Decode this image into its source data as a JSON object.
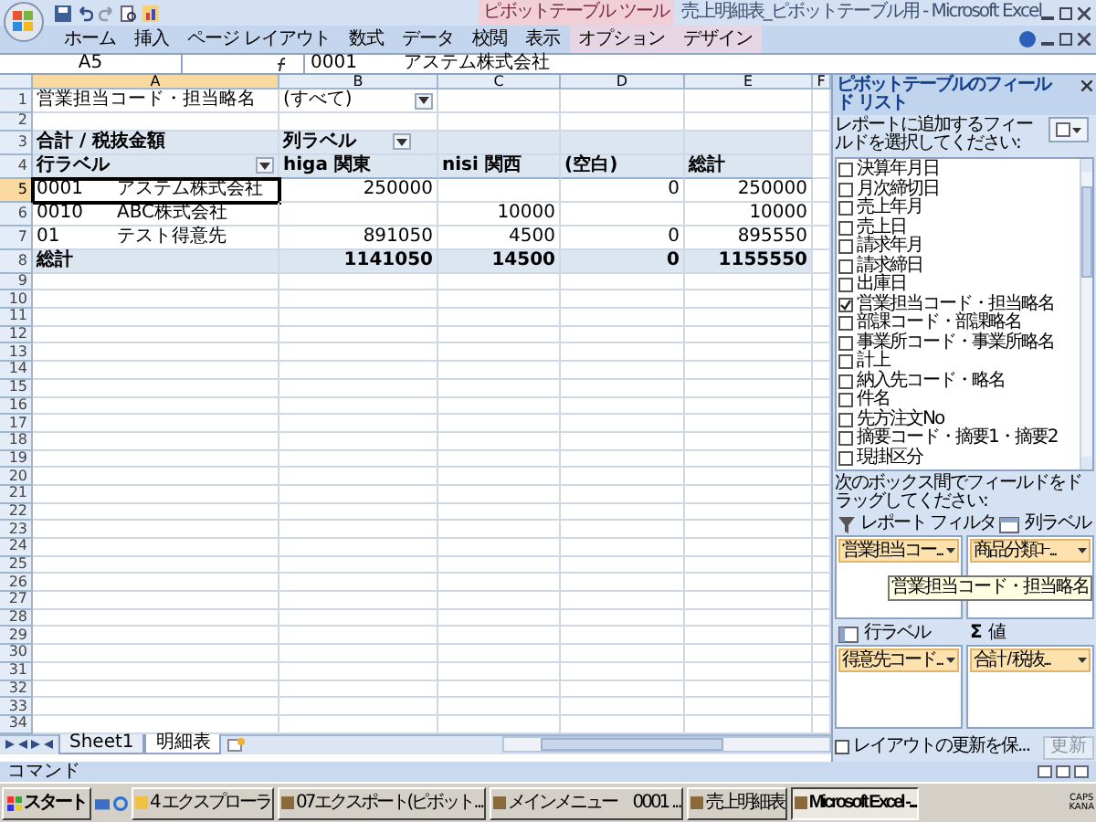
{
  "window": {
    "title": "売上明細表_ピボットテーブル用 - Microsoft Excel",
    "context_tab_group": "ピボットテーブル ツール"
  },
  "ribbon_tabs": [
    {
      "label": "ホーム",
      "contextual": false
    },
    {
      "label": "挿入",
      "contextual": false
    },
    {
      "label": "ページ レイアウト",
      "contextual": false
    },
    {
      "label": "数式",
      "contextual": false
    },
    {
      "label": "データ",
      "contextual": false
    },
    {
      "label": "校閲",
      "contextual": false
    },
    {
      "label": "表示",
      "contextual": false
    },
    {
      "label": "オプション",
      "contextual": true
    },
    {
      "label": "デザイン",
      "contextual": true
    }
  ],
  "formula_bar": {
    "name_box": "A5",
    "value": "0001        アステム株式会社"
  },
  "columns": [
    "A",
    "B",
    "C",
    "D",
    "E",
    "F"
  ],
  "rows": [
    {
      "number": "1",
      "kind": "filter",
      "selected": false,
      "a": "営業担当コード・担当略名",
      "b": "(すべて)"
    },
    {
      "number": "2",
      "kind": "empty",
      "selected": false
    },
    {
      "number": "3",
      "kind": "title",
      "selected": false,
      "a": "合計 / 税抜金額",
      "b": "列ラベル"
    },
    {
      "number": "4",
      "kind": "heads",
      "selected": false,
      "a": "行ラベル",
      "b": "higa 関東",
      "c": "nisi 関西",
      "d": "(空白)",
      "e": "総計"
    },
    {
      "number": "5",
      "kind": "data",
      "selected": true,
      "code": "0001",
      "name": "アステム株式会社",
      "b": "250000",
      "d": "0",
      "e": "250000"
    },
    {
      "number": "6",
      "kind": "data",
      "selected": false,
      "code": "0010",
      "name": "ABC株式会社",
      "c": "10000",
      "e": "10000"
    },
    {
      "number": "7",
      "kind": "data",
      "selected": false,
      "code": "01",
      "name": "テスト得意先",
      "b": "891050",
      "c": "4500",
      "d": "0",
      "e": "895550"
    },
    {
      "number": "8",
      "kind": "total",
      "selected": false,
      "a": "総計",
      "b": "1141050",
      "c": "14500",
      "d": "0",
      "e": "1155550"
    },
    {
      "number": "9",
      "kind": "empty",
      "selected": false
    },
    {
      "number": "10",
      "kind": "empty",
      "selected": false
    },
    {
      "number": "11",
      "kind": "empty",
      "selected": false
    },
    {
      "number": "12",
      "kind": "empty",
      "selected": false
    },
    {
      "number": "13",
      "kind": "empty",
      "selected": false
    },
    {
      "number": "14",
      "kind": "empty",
      "selected": false
    },
    {
      "number": "15",
      "kind": "empty",
      "selected": false
    },
    {
      "number": "16",
      "kind": "empty",
      "selected": false
    },
    {
      "number": "17",
      "kind": "empty",
      "selected": false
    },
    {
      "number": "18",
      "kind": "empty",
      "selected": false
    },
    {
      "number": "19",
      "kind": "empty",
      "selected": false
    },
    {
      "number": "20",
      "kind": "empty",
      "selected": false
    },
    {
      "number": "21",
      "kind": "empty",
      "selected": false
    },
    {
      "number": "22",
      "kind": "empty",
      "selected": false
    },
    {
      "number": "23",
      "kind": "empty",
      "selected": false
    },
    {
      "number": "24",
      "kind": "empty",
      "selected": false
    },
    {
      "number": "25",
      "kind": "empty",
      "selected": false
    },
    {
      "number": "26",
      "kind": "empty",
      "selected": false
    },
    {
      "number": "27",
      "kind": "empty",
      "selected": false
    },
    {
      "number": "28",
      "kind": "empty",
      "selected": false
    },
    {
      "number": "29",
      "kind": "empty",
      "selected": false
    },
    {
      "number": "30",
      "kind": "empty",
      "selected": false
    },
    {
      "number": "31",
      "kind": "empty",
      "selected": false
    },
    {
      "number": "32",
      "kind": "empty",
      "selected": false
    },
    {
      "number": "33",
      "kind": "empty",
      "selected": false
    },
    {
      "number": "34",
      "kind": "empty",
      "selected": false
    }
  ],
  "sheet_tabs": [
    {
      "label": "Sheet1",
      "selected": false
    },
    {
      "label": "明細表",
      "selected": true
    }
  ],
  "status_bar": {
    "mode": "コマンド"
  },
  "field_list": {
    "title": "ピボットテーブルのフィールド リスト",
    "instruction": "レポートに追加するフィールドを選択してください:",
    "fields": [
      {
        "label": "決算年月日",
        "checked": false
      },
      {
        "label": "月次締切日",
        "checked": false
      },
      {
        "label": "売上年月",
        "checked": false
      },
      {
        "label": "売上日",
        "checked": false
      },
      {
        "label": "請求年月",
        "checked": false
      },
      {
        "label": "請求締日",
        "checked": false
      },
      {
        "label": "出庫日",
        "checked": false
      },
      {
        "label": "営業担当コード・担当略名",
        "checked": true
      },
      {
        "label": "部課コード・部課略名",
        "checked": false
      },
      {
        "label": "事業所コード・事業所略名",
        "checked": false
      },
      {
        "label": "計上",
        "checked": false
      },
      {
        "label": "納入先コード・略名",
        "checked": false
      },
      {
        "label": "件名",
        "checked": false
      },
      {
        "label": "先方注文No",
        "checked": false
      },
      {
        "label": "摘要コード・摘要1・摘要2",
        "checked": false
      },
      {
        "label": "現掛区分",
        "checked": false
      }
    ],
    "areas_instruction": "次のボックス間でフィールドをドラッグしてください:",
    "areas": [
      {
        "kind": "filter",
        "label": "レポート フィルタ",
        "chip": "営業担当コー..."
      },
      {
        "kind": "columns",
        "label": "列ラベル",
        "chip": "商品分類ｺｰ..."
      },
      {
        "kind": "rows",
        "label": "行ラベル",
        "chip": "得意先コード..."
      },
      {
        "kind": "values",
        "symbol": "Σ",
        "label": "値",
        "chip": "合計 / 税抜..."
      }
    ],
    "tooltip": "営業担当コード・担当略名",
    "defer_update": {
      "label": "レイアウトの更新を保...",
      "checked": false
    },
    "update_button": {
      "label": "更新",
      "disabled": true
    }
  },
  "taskbar": {
    "start": "スタート",
    "items": [
      {
        "label": "4 エクスプローラ",
        "selected": false
      },
      {
        "label": "07エクスポート(ピボット...",
        "selected": false
      },
      {
        "label": "メインメニュー　0001 ...",
        "selected": false
      },
      {
        "label": "売上明細表",
        "selected": false
      },
      {
        "label": "Microsoft Excel -...",
        "selected": true
      }
    ],
    "tray": [
      "CAPS",
      "KANA"
    ]
  }
}
